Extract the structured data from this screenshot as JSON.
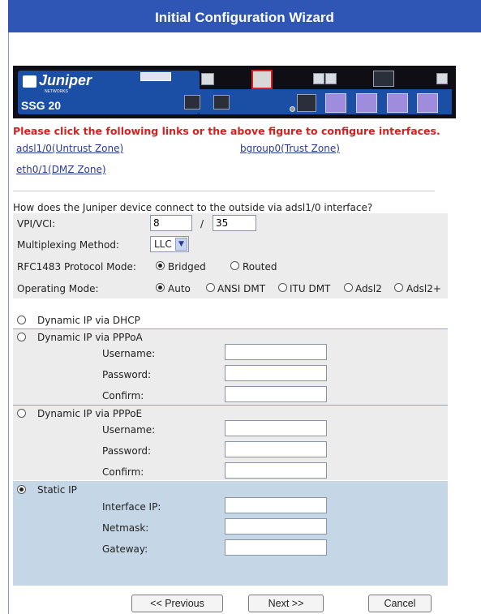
{
  "title": "Initial Configuration Wizard",
  "device": {
    "brand": "Juniper",
    "brand_sub": "NETWORKS",
    "model": "SSG 20"
  },
  "instruction": "Please click the following links or the above figure to configure interfaces.",
  "links": {
    "untrust": "adsl1/0(Untrust Zone)",
    "trust": "bgroup0(Trust Zone)",
    "dmz": "eth0/1(DMZ Zone)"
  },
  "question": "How does the Juniper device connect to the outside via adsl1/0 interface?",
  "settings": {
    "vpi_vci_label": "VPI/VCI:",
    "vpi_value": "8",
    "separator": "/",
    "vci_value": "35",
    "mux_label": "Multiplexing Method:",
    "mux_value": "LLC",
    "rfc_label": "RFC1483 Protocol Mode:",
    "rfc_options": [
      "Bridged",
      "Routed"
    ],
    "rfc_selected": "Bridged",
    "opmode_label": "Operating Mode:",
    "opmode_options": [
      "Auto",
      "ANSI DMT",
      "ITU DMT",
      "Adsl2",
      "Adsl2+"
    ],
    "opmode_selected": "Auto"
  },
  "connection": {
    "dhcp_label": "Dynamic IP via DHCP",
    "pppoa_label": "Dynamic IP via PPPoA",
    "pppoe_label": "Dynamic IP via PPPoE",
    "static_label": "Static IP",
    "selected": "Static IP",
    "username_label": "Username:",
    "password_label": "Password:",
    "confirm_label": "Confirm:",
    "interface_ip_label": "Interface IP:",
    "netmask_label": "Netmask:",
    "gateway_label": "Gateway:"
  },
  "buttons": {
    "previous": "<< Previous",
    "next": "Next >>",
    "cancel": "Cancel"
  }
}
